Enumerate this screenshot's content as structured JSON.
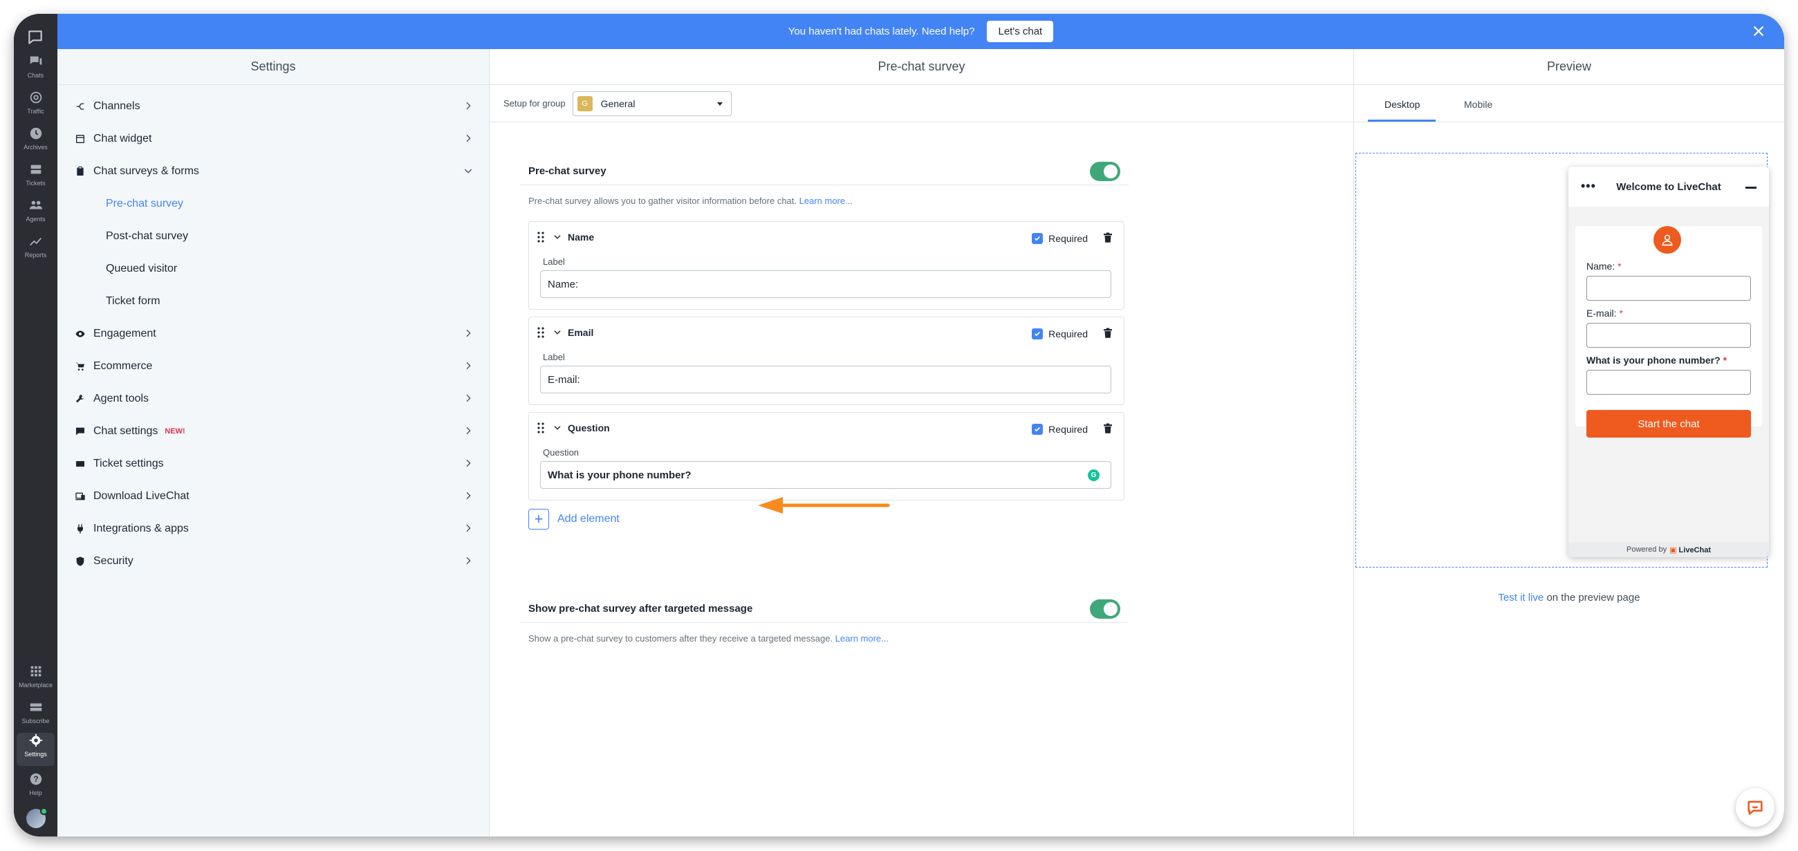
{
  "banner": {
    "text": "You haven't had chats lately. Need help?",
    "button": "Let's chat"
  },
  "rail": {
    "top": [
      {
        "label": "Chats",
        "icon": "chats-icon"
      },
      {
        "label": "Traffic",
        "icon": "traffic-icon"
      },
      {
        "label": "Archives",
        "icon": "archives-icon"
      },
      {
        "label": "Tickets",
        "icon": "tickets-icon"
      },
      {
        "label": "Agents",
        "icon": "agents-icon"
      },
      {
        "label": "Reports",
        "icon": "reports-icon"
      }
    ],
    "bottom": [
      {
        "label": "Marketplace",
        "icon": "marketplace-icon"
      },
      {
        "label": "Subscribe",
        "icon": "subscribe-icon"
      },
      {
        "label": "Settings",
        "icon": "settings-icon"
      },
      {
        "label": "Help",
        "icon": "help-icon"
      }
    ]
  },
  "settings": {
    "title": "Settings",
    "items": [
      {
        "label": "Channels"
      },
      {
        "label": "Chat widget"
      },
      {
        "label": "Chat surveys & forms"
      },
      {
        "label": "Pre-chat survey"
      },
      {
        "label": "Post-chat survey"
      },
      {
        "label": "Queued visitor"
      },
      {
        "label": "Ticket form"
      },
      {
        "label": "Engagement"
      },
      {
        "label": "Ecommerce"
      },
      {
        "label": "Agent tools"
      },
      {
        "label": "Chat settings",
        "badge": "NEW!"
      },
      {
        "label": "Ticket settings"
      },
      {
        "label": "Download LiveChat"
      },
      {
        "label": "Integrations & apps"
      },
      {
        "label": "Security"
      }
    ]
  },
  "center": {
    "title": "Pre-chat survey",
    "group_label": "Setup for group",
    "group_initial": "G",
    "group_value": "General",
    "survey_title": "Pre-chat survey",
    "survey_desc": "Pre-chat survey allows you to gather visitor information before chat.",
    "learn_more": "Learn more...",
    "fields": [
      {
        "name": "Name",
        "required": "Required",
        "sublabel": "Label",
        "value": "Name:"
      },
      {
        "name": "Email",
        "required": "Required",
        "sublabel": "Label",
        "value": "E-mail:"
      },
      {
        "name": "Question",
        "required": "Required",
        "sublabel": "Question",
        "value": "What is your phone number?"
      }
    ],
    "add_element": "Add element",
    "targeted_title": "Show pre-chat survey after targeted message",
    "targeted_desc": "Show a pre-chat survey to customers after they receive a targeted message.",
    "targeted_learn_more": "Learn more..."
  },
  "preview": {
    "title": "Preview",
    "tabs": [
      "Desktop",
      "Mobile"
    ],
    "widget": {
      "title": "Welcome to LiveChat",
      "name_label": "Name:",
      "email_label": "E-mail:",
      "question_label": "What is your phone number?",
      "required_mark": "*",
      "button": "Start the chat",
      "powered_by": "Powered by",
      "brand": "LiveChat"
    },
    "test_link": "Test it live",
    "test_suffix": "on the preview page"
  },
  "colors": {
    "accent": "#4384f5",
    "toggle_on": "#3fa87a",
    "widget_orange": "#ef5a1e",
    "arrow": "#f68a1e"
  }
}
